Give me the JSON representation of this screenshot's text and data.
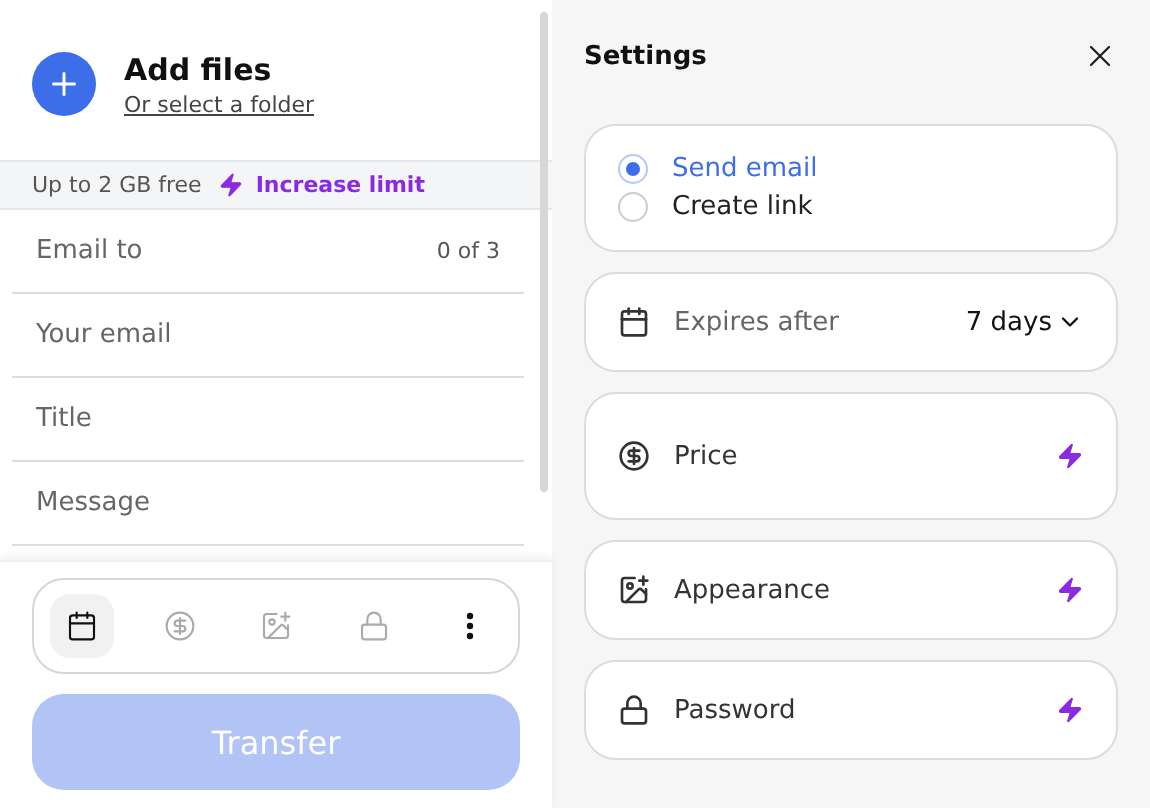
{
  "upload": {
    "title": "Add files",
    "link": "Or select a folder"
  },
  "limit": {
    "text": "Up to 2 GB free",
    "action": "Increase limit"
  },
  "fields": [
    {
      "placeholder": "Email to",
      "counter": "0 of 3"
    },
    {
      "placeholder": "Your email"
    },
    {
      "placeholder": "Title"
    },
    {
      "placeholder": "Message"
    }
  ],
  "toolbar": [
    {
      "kind": "calendar",
      "selected": true
    },
    {
      "kind": "price",
      "selected": false
    },
    {
      "kind": "image",
      "selected": false
    },
    {
      "kind": "lock",
      "selected": false
    },
    {
      "kind": "more",
      "selected": false
    }
  ],
  "transfer_button": {
    "label": "Transfer",
    "disabled": true
  },
  "settings": {
    "title": "Settings",
    "cards": [
      {
        "kind": "radio-group",
        "options": [
          {
            "label": "Send email",
            "selected": true
          },
          {
            "label": "Create link",
            "selected": false
          }
        ]
      },
      {
        "kind": "expiry",
        "label": "Expires after",
        "value": "7 days"
      },
      {
        "kind": "price",
        "label": "Price"
      },
      {
        "kind": "appearance",
        "label": "Appearance"
      },
      {
        "kind": "password",
        "label": "Password"
      }
    ]
  }
}
